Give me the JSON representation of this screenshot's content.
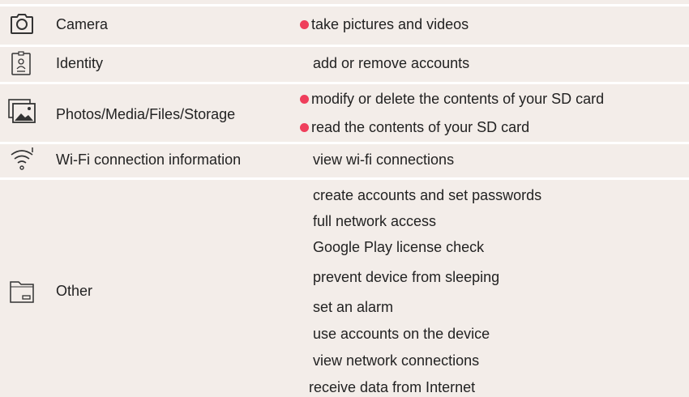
{
  "colors": {
    "background": "#f3ede9",
    "divider": "#ffffff",
    "dangerous_dot": "#ef3e5b",
    "text": "#222222",
    "icon": "#333333"
  },
  "groups": [
    {
      "icon": "camera-icon",
      "label": "Camera",
      "permissions": [
        {
          "text": "take pictures and videos",
          "dangerous": true
        }
      ]
    },
    {
      "icon": "identity-badge-icon",
      "label": "Identity",
      "permissions": [
        {
          "text": "add or remove accounts",
          "dangerous": false
        }
      ]
    },
    {
      "icon": "photos-media-icon",
      "label": "Photos/Media/Files/Storage",
      "permissions": [
        {
          "text": "modify or delete the contents of your SD card",
          "dangerous": true
        },
        {
          "text": "read the contents of your SD card",
          "dangerous": true
        }
      ]
    },
    {
      "icon": "wifi-info-icon",
      "label": "Wi-Fi connection information",
      "permissions": [
        {
          "text": "view wi-fi connections",
          "dangerous": false
        }
      ]
    },
    {
      "icon": "folder-icon",
      "label": "Other",
      "permissions": [
        {
          "text": "create accounts and set passwords",
          "dangerous": false
        },
        {
          "text": "full network access",
          "dangerous": false
        },
        {
          "text": "Google Play license check",
          "dangerous": false
        },
        {
          "text": "prevent device from sleeping",
          "dangerous": false
        },
        {
          "text": "set an alarm",
          "dangerous": false
        },
        {
          "text": "use accounts on the device",
          "dangerous": false
        },
        {
          "text": "view network connections",
          "dangerous": false
        },
        {
          "text": "receive data from Internet",
          "dangerous": false
        }
      ]
    }
  ]
}
